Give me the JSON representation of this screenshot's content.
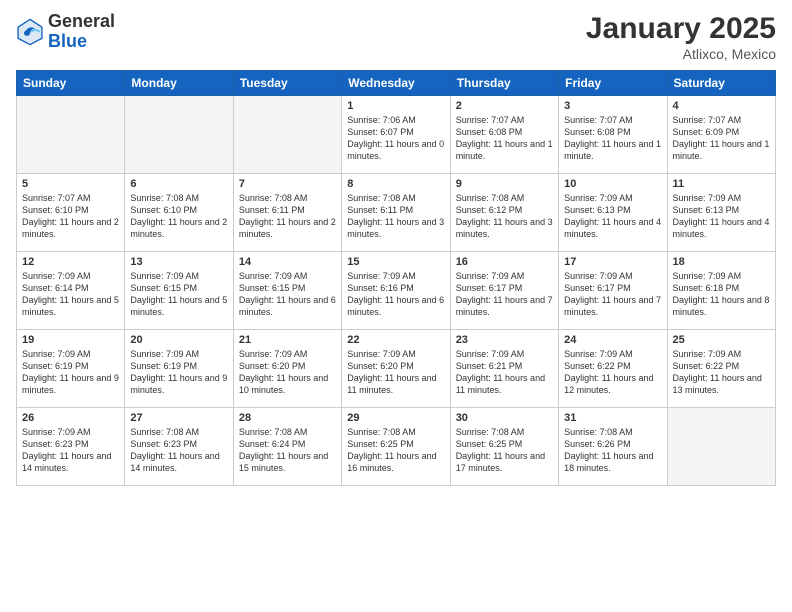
{
  "header": {
    "logo_line1": "General",
    "logo_line2": "Blue",
    "month": "January 2025",
    "location": "Atlixco, Mexico"
  },
  "weekdays": [
    "Sunday",
    "Monday",
    "Tuesday",
    "Wednesday",
    "Thursday",
    "Friday",
    "Saturday"
  ],
  "weeks": [
    [
      {
        "day": "",
        "empty": true
      },
      {
        "day": "",
        "empty": true
      },
      {
        "day": "",
        "empty": true
      },
      {
        "day": "1",
        "sunrise": "7:06 AM",
        "sunset": "6:07 PM",
        "daylight": "11 hours and 0 minutes."
      },
      {
        "day": "2",
        "sunrise": "7:07 AM",
        "sunset": "6:08 PM",
        "daylight": "11 hours and 1 minute."
      },
      {
        "day": "3",
        "sunrise": "7:07 AM",
        "sunset": "6:08 PM",
        "daylight": "11 hours and 1 minute."
      },
      {
        "day": "4",
        "sunrise": "7:07 AM",
        "sunset": "6:09 PM",
        "daylight": "11 hours and 1 minute."
      }
    ],
    [
      {
        "day": "5",
        "sunrise": "7:07 AM",
        "sunset": "6:10 PM",
        "daylight": "11 hours and 2 minutes."
      },
      {
        "day": "6",
        "sunrise": "7:08 AM",
        "sunset": "6:10 PM",
        "daylight": "11 hours and 2 minutes."
      },
      {
        "day": "7",
        "sunrise": "7:08 AM",
        "sunset": "6:11 PM",
        "daylight": "11 hours and 2 minutes."
      },
      {
        "day": "8",
        "sunrise": "7:08 AM",
        "sunset": "6:11 PM",
        "daylight": "11 hours and 3 minutes."
      },
      {
        "day": "9",
        "sunrise": "7:08 AM",
        "sunset": "6:12 PM",
        "daylight": "11 hours and 3 minutes."
      },
      {
        "day": "10",
        "sunrise": "7:09 AM",
        "sunset": "6:13 PM",
        "daylight": "11 hours and 4 minutes."
      },
      {
        "day": "11",
        "sunrise": "7:09 AM",
        "sunset": "6:13 PM",
        "daylight": "11 hours and 4 minutes."
      }
    ],
    [
      {
        "day": "12",
        "sunrise": "7:09 AM",
        "sunset": "6:14 PM",
        "daylight": "11 hours and 5 minutes."
      },
      {
        "day": "13",
        "sunrise": "7:09 AM",
        "sunset": "6:15 PM",
        "daylight": "11 hours and 5 minutes."
      },
      {
        "day": "14",
        "sunrise": "7:09 AM",
        "sunset": "6:15 PM",
        "daylight": "11 hours and 6 minutes."
      },
      {
        "day": "15",
        "sunrise": "7:09 AM",
        "sunset": "6:16 PM",
        "daylight": "11 hours and 6 minutes."
      },
      {
        "day": "16",
        "sunrise": "7:09 AM",
        "sunset": "6:17 PM",
        "daylight": "11 hours and 7 minutes."
      },
      {
        "day": "17",
        "sunrise": "7:09 AM",
        "sunset": "6:17 PM",
        "daylight": "11 hours and 7 minutes."
      },
      {
        "day": "18",
        "sunrise": "7:09 AM",
        "sunset": "6:18 PM",
        "daylight": "11 hours and 8 minutes."
      }
    ],
    [
      {
        "day": "19",
        "sunrise": "7:09 AM",
        "sunset": "6:19 PM",
        "daylight": "11 hours and 9 minutes."
      },
      {
        "day": "20",
        "sunrise": "7:09 AM",
        "sunset": "6:19 PM",
        "daylight": "11 hours and 9 minutes."
      },
      {
        "day": "21",
        "sunrise": "7:09 AM",
        "sunset": "6:20 PM",
        "daylight": "11 hours and 10 minutes."
      },
      {
        "day": "22",
        "sunrise": "7:09 AM",
        "sunset": "6:20 PM",
        "daylight": "11 hours and 11 minutes."
      },
      {
        "day": "23",
        "sunrise": "7:09 AM",
        "sunset": "6:21 PM",
        "daylight": "11 hours and 11 minutes."
      },
      {
        "day": "24",
        "sunrise": "7:09 AM",
        "sunset": "6:22 PM",
        "daylight": "11 hours and 12 minutes."
      },
      {
        "day": "25",
        "sunrise": "7:09 AM",
        "sunset": "6:22 PM",
        "daylight": "11 hours and 13 minutes."
      }
    ],
    [
      {
        "day": "26",
        "sunrise": "7:09 AM",
        "sunset": "6:23 PM",
        "daylight": "11 hours and 14 minutes."
      },
      {
        "day": "27",
        "sunrise": "7:08 AM",
        "sunset": "6:23 PM",
        "daylight": "11 hours and 14 minutes."
      },
      {
        "day": "28",
        "sunrise": "7:08 AM",
        "sunset": "6:24 PM",
        "daylight": "11 hours and 15 minutes."
      },
      {
        "day": "29",
        "sunrise": "7:08 AM",
        "sunset": "6:25 PM",
        "daylight": "11 hours and 16 minutes."
      },
      {
        "day": "30",
        "sunrise": "7:08 AM",
        "sunset": "6:25 PM",
        "daylight": "11 hours and 17 minutes."
      },
      {
        "day": "31",
        "sunrise": "7:08 AM",
        "sunset": "6:26 PM",
        "daylight": "11 hours and 18 minutes."
      },
      {
        "day": "",
        "empty": true
      }
    ]
  ]
}
